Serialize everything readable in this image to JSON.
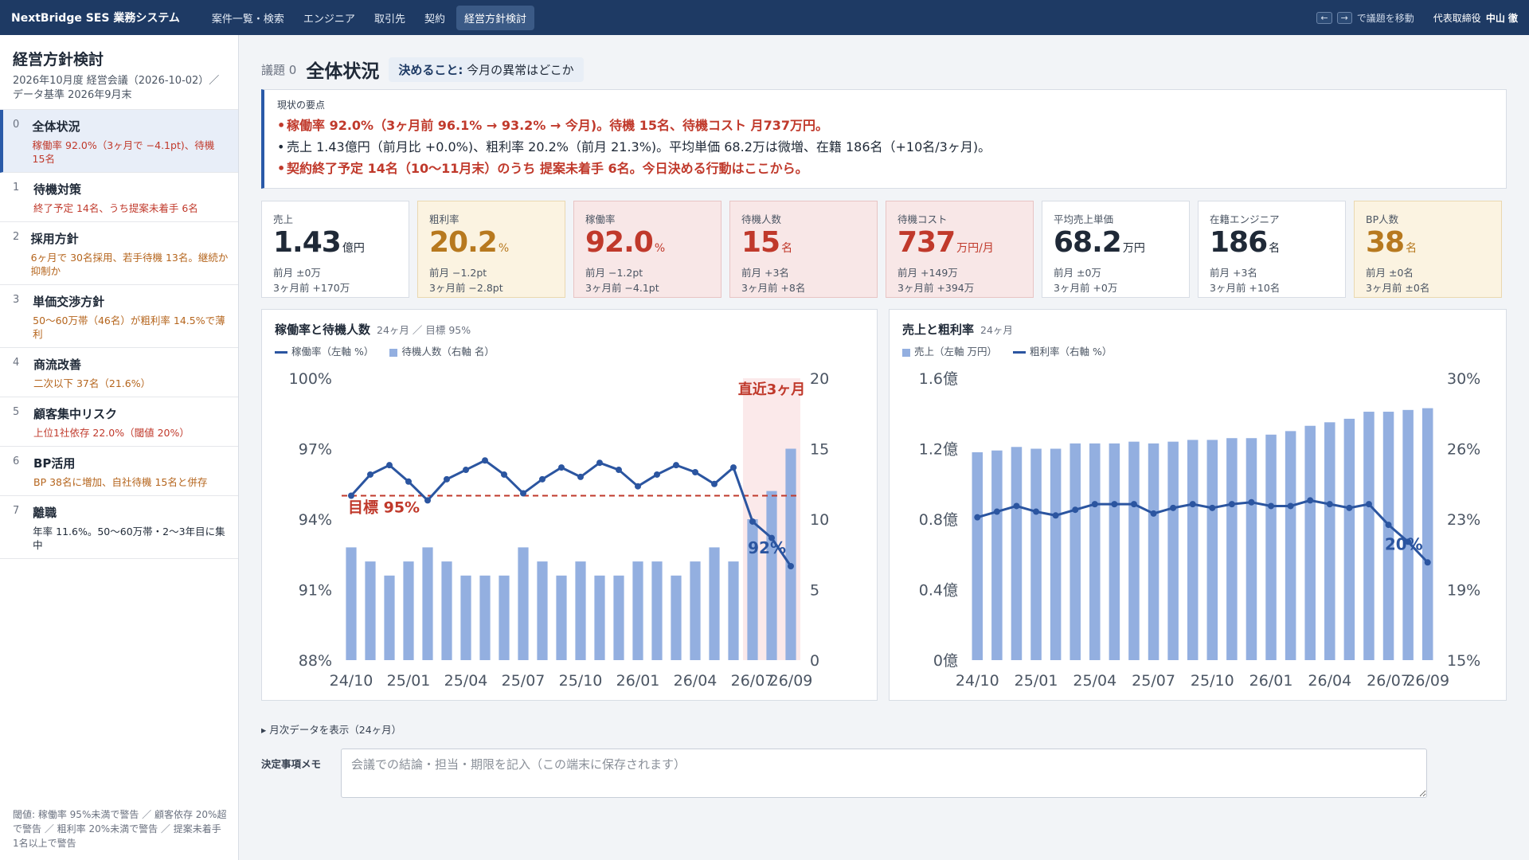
{
  "topbar": {
    "brand": "NextBridge SES 業務システム",
    "nav": [
      "案件一覧・検索",
      "エンジニア",
      "取引先",
      "契約",
      "経営方針検討"
    ],
    "hint": "で議題を移動",
    "key_left": "←",
    "key_right": "→",
    "user_role": "代表取締役",
    "user_name": "中山 徹"
  },
  "sidebar": {
    "title": "経営方針検討",
    "subtitle": "2026年10月度 経営会議（2026-10-02）／ データ基準 2026年9月末",
    "items": [
      {
        "num": "0",
        "label": "全体状況",
        "desc": "稼働率 92.0%（3ヶ月で −4.1pt)、待機 15名",
        "tone": "red"
      },
      {
        "num": "1",
        "label": "待機対策",
        "desc": "終了予定 14名、うち提案未着手 6名",
        "tone": "red"
      },
      {
        "num": "2",
        "label": "採用方針",
        "desc": "6ヶ月で 30名採用、若手待機 13名。継続か抑制か",
        "tone": "orange"
      },
      {
        "num": "3",
        "label": "単価交渉方針",
        "desc": "50〜60万帯（46名）が粗利率 14.5%で薄利",
        "tone": "orange"
      },
      {
        "num": "4",
        "label": "商流改善",
        "desc": "二次以下 37名（21.6%）",
        "tone": "orange"
      },
      {
        "num": "5",
        "label": "顧客集中リスク",
        "desc": "上位1社依存 22.0%（閾値 20%）",
        "tone": "red"
      },
      {
        "num": "6",
        "label": "BP活用",
        "desc": "BP 38名に増加、自社待機 15名と併存",
        "tone": "orange"
      },
      {
        "num": "7",
        "label": "離職",
        "desc": "年率 11.6%。50〜60万帯・2〜3年目に集中",
        "tone": "none"
      }
    ],
    "footer": "閾値: 稼働率 95%未満で警告 ／ 顧客依存 20%超で警告 ／ 粗利率 20%未満で警告 ／ 提案未着手 1名以上で警告"
  },
  "agenda": {
    "label": "議題 0",
    "title": "全体状況",
    "decide_label": "決めること:",
    "decide_text": "今月の異常はどこか"
  },
  "summary": {
    "caption": "現状の要点",
    "lines": [
      "稼働率 92.0%（3ヶ月前 96.1% → 93.2% → 今月)。待機 15名、待機コスト 月737万円。",
      "売上 1.43億円（前月比 +0.0%)、粗利率 20.2%（前月 21.3%)。平均単価 68.2万は微増、在籍 186名（+10名/3ヶ月)。",
      "契約終了予定 14名（10〜11月末）のうち 提案未着手 6名。今日決める行動はここから。"
    ]
  },
  "kpis": [
    {
      "label": "売上",
      "value": "1.43",
      "unit": "億円",
      "d1": "前月 ±0万",
      "d1c": "",
      "d2": "3ヶ月前 +170万",
      "d2c": "green",
      "tone": ""
    },
    {
      "label": "粗利率",
      "value": "20.2",
      "unit": "%",
      "d1": "前月 −1.2pt",
      "d1c": "red",
      "d2": "3ヶ月前 −2.8pt",
      "d2c": "red",
      "tone": "warn"
    },
    {
      "label": "稼働率",
      "value": "92.0",
      "unit": "%",
      "d1": "前月 −1.2pt",
      "d1c": "red",
      "d2": "3ヶ月前 −4.1pt",
      "d2c": "red",
      "tone": "alert"
    },
    {
      "label": "待機人数",
      "value": "15",
      "unit": "名",
      "d1": "前月 +3名",
      "d1c": "red",
      "d2": "3ヶ月前 +8名",
      "d2c": "red",
      "tone": "alert"
    },
    {
      "label": "待機コスト",
      "value": "737",
      "unit": "万円/月",
      "d1": "前月 +149万",
      "d1c": "red",
      "d2": "3ヶ月前 +394万",
      "d2c": "red",
      "tone": "alert"
    },
    {
      "label": "平均売上単価",
      "value": "68.2",
      "unit": "万円",
      "d1": "前月 ±0万",
      "d1c": "",
      "d2": "3ヶ月前 +0万",
      "d2c": "green",
      "tone": ""
    },
    {
      "label": "在籍エンジニア",
      "value": "186",
      "unit": "名",
      "d1": "前月 +3名",
      "d1c": "green",
      "d2": "3ヶ月前 +10名",
      "d2c": "green",
      "tone": ""
    },
    {
      "label": "BP人数",
      "value": "38",
      "unit": "名",
      "d1": "前月 ±0名",
      "d1c": "",
      "d2": "3ヶ月前 ±0名",
      "d2c": "",
      "tone": "warn"
    }
  ],
  "chart_data": [
    {
      "type": "bar+line",
      "title": "稼働率と待機人数",
      "subtitle": "24ヶ月 ／ 目標 95%",
      "x_ticks": [
        "24/10",
        "25/01",
        "25/04",
        "25/07",
        "25/10",
        "26/01",
        "26/04",
        "26/07",
        "26/09"
      ],
      "series": [
        {
          "name": "稼働率（左軸 %）",
          "type": "line",
          "values": [
            95,
            95.9,
            96.3,
            95.6,
            94.8,
            95.7,
            96.1,
            96.5,
            95.9,
            95.1,
            95.7,
            96.2,
            95.8,
            96.4,
            96.1,
            95.4,
            95.9,
            96.3,
            96.0,
            95.5,
            96.2,
            93.9,
            93.2,
            92.0
          ]
        },
        {
          "name": "待機人数（右軸 名）",
          "type": "bar",
          "values": [
            8,
            7,
            6,
            7,
            8,
            7,
            6,
            6,
            6,
            8,
            7,
            6,
            7,
            6,
            6,
            7,
            7,
            6,
            7,
            8,
            7,
            10,
            12,
            15
          ]
        }
      ],
      "y_left": {
        "ticks": [
          "100%",
          "97%",
          "94%",
          "91%",
          "88%"
        ],
        "range": [
          88,
          100
        ]
      },
      "y_right": {
        "ticks": [
          "20",
          "15",
          "10",
          "5",
          "0"
        ],
        "range": [
          0,
          20
        ]
      },
      "target": {
        "value": 95,
        "label": "目標 95%"
      },
      "highlight_label": "直近3ヶ月",
      "end_label": "92%"
    },
    {
      "type": "bar+line",
      "title": "売上と粗利率",
      "subtitle": "24ヶ月",
      "x_ticks": [
        "24/10",
        "25/01",
        "25/04",
        "25/07",
        "25/10",
        "26/01",
        "26/04",
        "26/07",
        "26/09"
      ],
      "series": [
        {
          "name": "売上（左軸 万円）",
          "type": "bar",
          "values": [
            1.18,
            1.19,
            1.21,
            1.2,
            1.2,
            1.23,
            1.23,
            1.23,
            1.24,
            1.23,
            1.24,
            1.25,
            1.25,
            1.26,
            1.26,
            1.28,
            1.3,
            1.33,
            1.35,
            1.37,
            1.41,
            1.41,
            1.42,
            1.43
          ]
        },
        {
          "name": "粗利率（右軸 %）",
          "type": "line",
          "values": [
            22.6,
            22.9,
            23.2,
            22.9,
            22.7,
            23.0,
            23.3,
            23.3,
            23.3,
            22.8,
            23.1,
            23.3,
            23.1,
            23.3,
            23.4,
            23.2,
            23.2,
            23.5,
            23.3,
            23.1,
            23.3,
            22.2,
            21.3,
            20.2
          ]
        }
      ],
      "y_left": {
        "ticks": [
          "1.6億",
          "1.2億",
          "0.8億",
          "0.4億",
          "0億"
        ],
        "range": [
          0,
          1.6
        ]
      },
      "y_right": {
        "ticks": [
          "30%",
          "26%",
          "23%",
          "19%",
          "15%"
        ],
        "range": [
          15,
          30
        ]
      },
      "end_label": "20%"
    }
  ],
  "monthly_toggle": "▸ 月次データを表示（24ヶ月）",
  "memo": {
    "label": "決定事項メモ",
    "placeholder": "会議での結論・担当・期限を記入（この端末に保存されます）"
  }
}
